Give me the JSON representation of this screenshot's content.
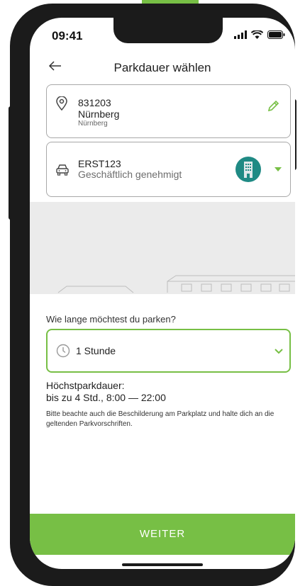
{
  "status_bar": {
    "time": "09:41"
  },
  "header": {
    "title": "Parkdauer wählen",
    "back_icon": "arrow-left-icon"
  },
  "location_card": {
    "zone": "831203",
    "city": "Nürnberg",
    "subtitle": "Nürnberg",
    "icon": "location-pin-icon",
    "edit_icon": "pencil-icon"
  },
  "vehicle_card": {
    "plate": "ERST123",
    "permission": "Geschäftlich genehmigt",
    "icon": "car-icon",
    "badge_icon": "business-building-icon",
    "dropdown_icon": "caret-down-icon"
  },
  "duration": {
    "question": "Wie lange möchtest du parken?",
    "selected": "1 Stunde",
    "clock_icon": "clock-icon",
    "chevron_icon": "chevron-down-icon"
  },
  "info": {
    "max_title": "Höchstparkdauer:",
    "max_hours": "bis zu 4 Std., 8:00 — 22:00",
    "note": "Bitte beachte auch die Beschilderung am Parkplatz und halte dich an die geltenden Parkvorschriften."
  },
  "footer": {
    "button_label": "WEITER"
  },
  "colors": {
    "accent": "#77bf45",
    "border": "#a8a8a8",
    "badge": "#1f8a84"
  }
}
